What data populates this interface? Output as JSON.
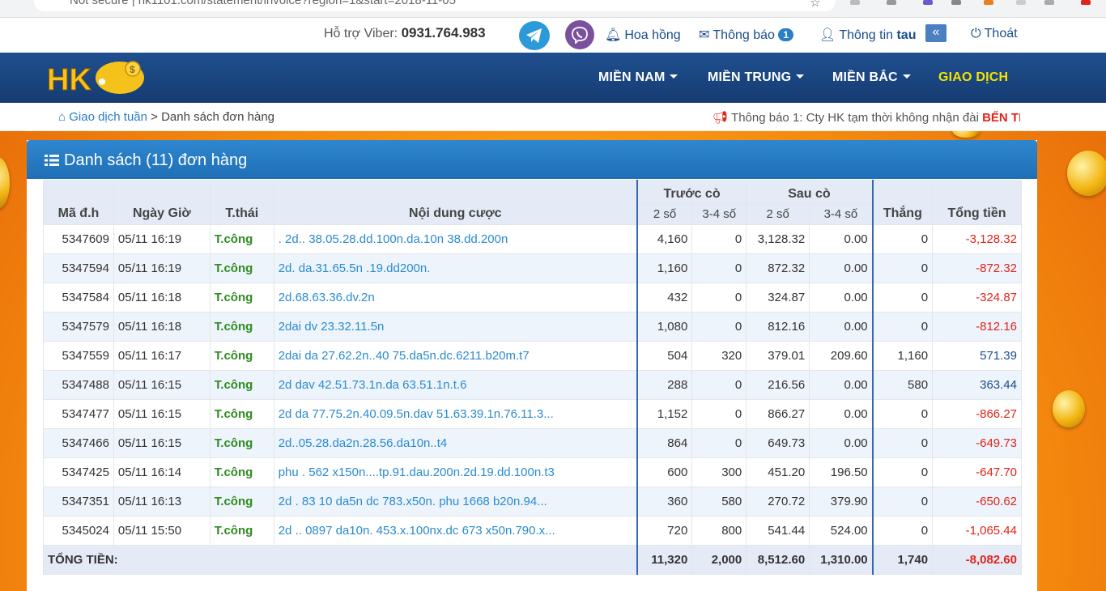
{
  "browser": {
    "address": "Not secure  |  hk1101.com/statement/invoice?region=1&start=2018-11-05"
  },
  "topbar": {
    "viber_label": "Hỗ trợ Viber: ",
    "viber_phone": "0931.764.983",
    "commission": "Hoa hồng",
    "notifications": "Thông báo",
    "notifications_count": "1",
    "account_info": "Thông tin ",
    "username": "tau",
    "logout": "Thoát"
  },
  "nav": {
    "logo": "HK",
    "items": [
      {
        "label": "MIỀN NAM"
      },
      {
        "label": "MIỀN TRUNG"
      },
      {
        "label": "MIỀN BẮC"
      },
      {
        "label": "GIAO DỊCH"
      }
    ]
  },
  "breadcrumb": {
    "parent": "Giao dịch tuần",
    "separator": " > ",
    "current": "Danh sách đơn hàng"
  },
  "ticker": {
    "text": "Thông báo 1: Cty HK tạm thời không nhận đài ",
    "highlight": "BẾN TRE"
  },
  "panel": {
    "title": "Danh sách (11) đơn hàng"
  },
  "table": {
    "headers": {
      "id": "Mã đ.h",
      "datetime": "Ngày Giờ",
      "status": "T.thái",
      "content": "Nội dung cược",
      "before": "Trước cò",
      "after": "Sau cò",
      "win": "Thắng",
      "total": "Tổng tiền",
      "two": "2 số",
      "threefour": "3-4 số"
    },
    "rows": [
      {
        "id": "5347609",
        "time": "05/11 16:19",
        "status": "T.công",
        "content": ". 2d.. 38.05.28.dd.100n.da.10n 38.dd.200n",
        "b2": "4,160",
        "b34": "0",
        "a2": "3,128.32",
        "a34": "0.00",
        "win": "0",
        "total": "-3,128.32"
      },
      {
        "id": "5347594",
        "time": "05/11 16:19",
        "status": "T.công",
        "content": "2d. da.31.65.5n .19.dd200n.",
        "b2": "1,160",
        "b34": "0",
        "a2": "872.32",
        "a34": "0.00",
        "win": "0",
        "total": "-872.32"
      },
      {
        "id": "5347584",
        "time": "05/11 16:18",
        "status": "T.công",
        "content": "2d.68.63.36.dv.2n",
        "b2": "432",
        "b34": "0",
        "a2": "324.87",
        "a34": "0.00",
        "win": "0",
        "total": "-324.87"
      },
      {
        "id": "5347579",
        "time": "05/11 16:18",
        "status": "T.công",
        "content": "2dai dv 23.32.11.5n",
        "b2": "1,080",
        "b34": "0",
        "a2": "812.16",
        "a34": "0.00",
        "win": "0",
        "total": "-812.16"
      },
      {
        "id": "5347559",
        "time": "05/11 16:17",
        "status": "T.công",
        "content": "2dai da 27.62.2n..40 75.da5n.dc.6211.b20m.t7",
        "b2": "504",
        "b34": "320",
        "a2": "379.01",
        "a34": "209.60",
        "win": "1,160",
        "total": "571.39"
      },
      {
        "id": "5347488",
        "time": "05/11 16:15",
        "status": "T.công",
        "content": "2d dav 42.51.73.1n.da 63.51.1n.t.6",
        "b2": "288",
        "b34": "0",
        "a2": "216.56",
        "a34": "0.00",
        "win": "580",
        "total": "363.44"
      },
      {
        "id": "5347477",
        "time": "05/11 16:15",
        "status": "T.công",
        "content": "2d da 77.75.2n.40.09.5n.dav 51.63.39.1n.76.11.3...",
        "b2": "1,152",
        "b34": "0",
        "a2": "866.27",
        "a34": "0.00",
        "win": "0",
        "total": "-866.27"
      },
      {
        "id": "5347466",
        "time": "05/11 16:15",
        "status": "T.công",
        "content": "2d..05.28.da2n.28.56.da10n..t4",
        "b2": "864",
        "b34": "0",
        "a2": "649.73",
        "a34": "0.00",
        "win": "0",
        "total": "-649.73"
      },
      {
        "id": "5347425",
        "time": "05/11 16:14",
        "status": "T.công",
        "content": "phu . 562 x150n....tp.91.dau.200n.2d.19.dd.100n.t3",
        "b2": "600",
        "b34": "300",
        "a2": "451.20",
        "a34": "196.50",
        "win": "0",
        "total": "-647.70"
      },
      {
        "id": "5347351",
        "time": "05/11 16:13",
        "status": "T.công",
        "content": "2d . 83 10 da5n dc 783.x50n. phu 1668 b20n.94...",
        "b2": "360",
        "b34": "580",
        "a2": "270.72",
        "a34": "379.90",
        "win": "0",
        "total": "-650.62"
      },
      {
        "id": "5345024",
        "time": "05/11 15:50",
        "status": "T.công",
        "content": "2d .. 0897 da10n. 453.x.100nx.dc 673 x50n.790.x...",
        "b2": "720",
        "b34": "800",
        "a2": "541.44",
        "a34": "524.00",
        "win": "0",
        "total": "-1,065.44"
      }
    ],
    "footer": {
      "label": "TỔNG TIỀN:",
      "b2": "11,320",
      "b34": "2,000",
      "a2": "8,512.60",
      "a34": "1,310.00",
      "win": "1,740",
      "total": "-8,082.60"
    }
  },
  "colors": {
    "nav_bg": "#1f4f8f",
    "panel_head": "#2f87cf",
    "positive": "#1a4d8c",
    "negative": "#e0241b",
    "status": "#2e8b20",
    "highlight_nav": "#f5e400"
  }
}
